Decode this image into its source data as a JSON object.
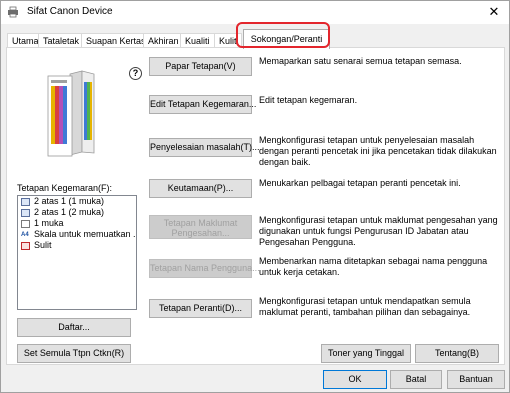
{
  "window": {
    "title": "Sifat Canon Device"
  },
  "tabs": [
    {
      "label": "Utama"
    },
    {
      "label": "Tataletak"
    },
    {
      "label": "Suapan Kertas"
    },
    {
      "label": "Akhiran"
    },
    {
      "label": "Kualiti"
    },
    {
      "label": "Kulit"
    },
    {
      "label": "Sokongan/Peranti"
    }
  ],
  "favorites": {
    "label": "Tetapan Kegemaran(F):",
    "items": [
      {
        "label": "2 atas 1 (1 muka)",
        "icon": "two-on-one-icon"
      },
      {
        "label": "2 atas 1 (2 muka)",
        "icon": "two-on-one-duplex-icon"
      },
      {
        "label": "1 muka",
        "icon": "one-sided-icon"
      },
      {
        "label": "Skala untuk memuatkan ...",
        "icon": "scale-a4-icon"
      },
      {
        "label": "Sulit",
        "icon": "confidential-icon"
      }
    ],
    "list_button": "Daftar...",
    "reset_button": "Set Semula Ttpn Ctkn(R)"
  },
  "actions": [
    {
      "button": "Papar Tetapan(V)",
      "desc": "Memaparkan satu senarai semua tetapan semasa.",
      "disabled": false
    },
    {
      "button": "Edit Tetapan Kegemaran...",
      "desc": "Edit tetapan kegemaran.",
      "disabled": false
    },
    {
      "button": "Penyelesaian masalah(T)...",
      "desc": "Mengkonfigurasi tetapan untuk penyelesaian masalah dengan peranti pencetak ini jika pencetakan tidak dilakukan dengan baik.",
      "disabled": false
    },
    {
      "button": "Keutamaan(P)...",
      "desc": "Menukarkan pelbagai tetapan peranti pencetak ini.",
      "disabled": false
    },
    {
      "button_line1": "Tetapan Maklumat",
      "button_line2": "Pengesahan...",
      "desc": "Mengkonfigurasi tetapan untuk maklumat pengesahan yang digunakan untuk fungsi Pengurusan ID Jabatan atau Pengesahan Pengguna.",
      "disabled": true
    },
    {
      "button": "Tetapan Nama Pengguna...",
      "desc": "Membenarkan nama ditetapkan sebagai nama pengguna untuk kerja cetakan.",
      "disabled": true
    },
    {
      "button": "Tetapan Peranti(D)...",
      "desc": "Mengkonfigurasi tetapan untuk mendapatkan semula maklumat peranti, tambahan pilihan dan sebagainya.",
      "disabled": false
    }
  ],
  "footer_panel": {
    "toner_button": "Toner yang Tinggal",
    "about_button": "Tentang(B)"
  },
  "dialog_buttons": {
    "ok": "OK",
    "cancel": "Batal",
    "help": "Bantuan"
  },
  "colors": {
    "accent": "#e3262d",
    "focus": "#0078d7"
  }
}
